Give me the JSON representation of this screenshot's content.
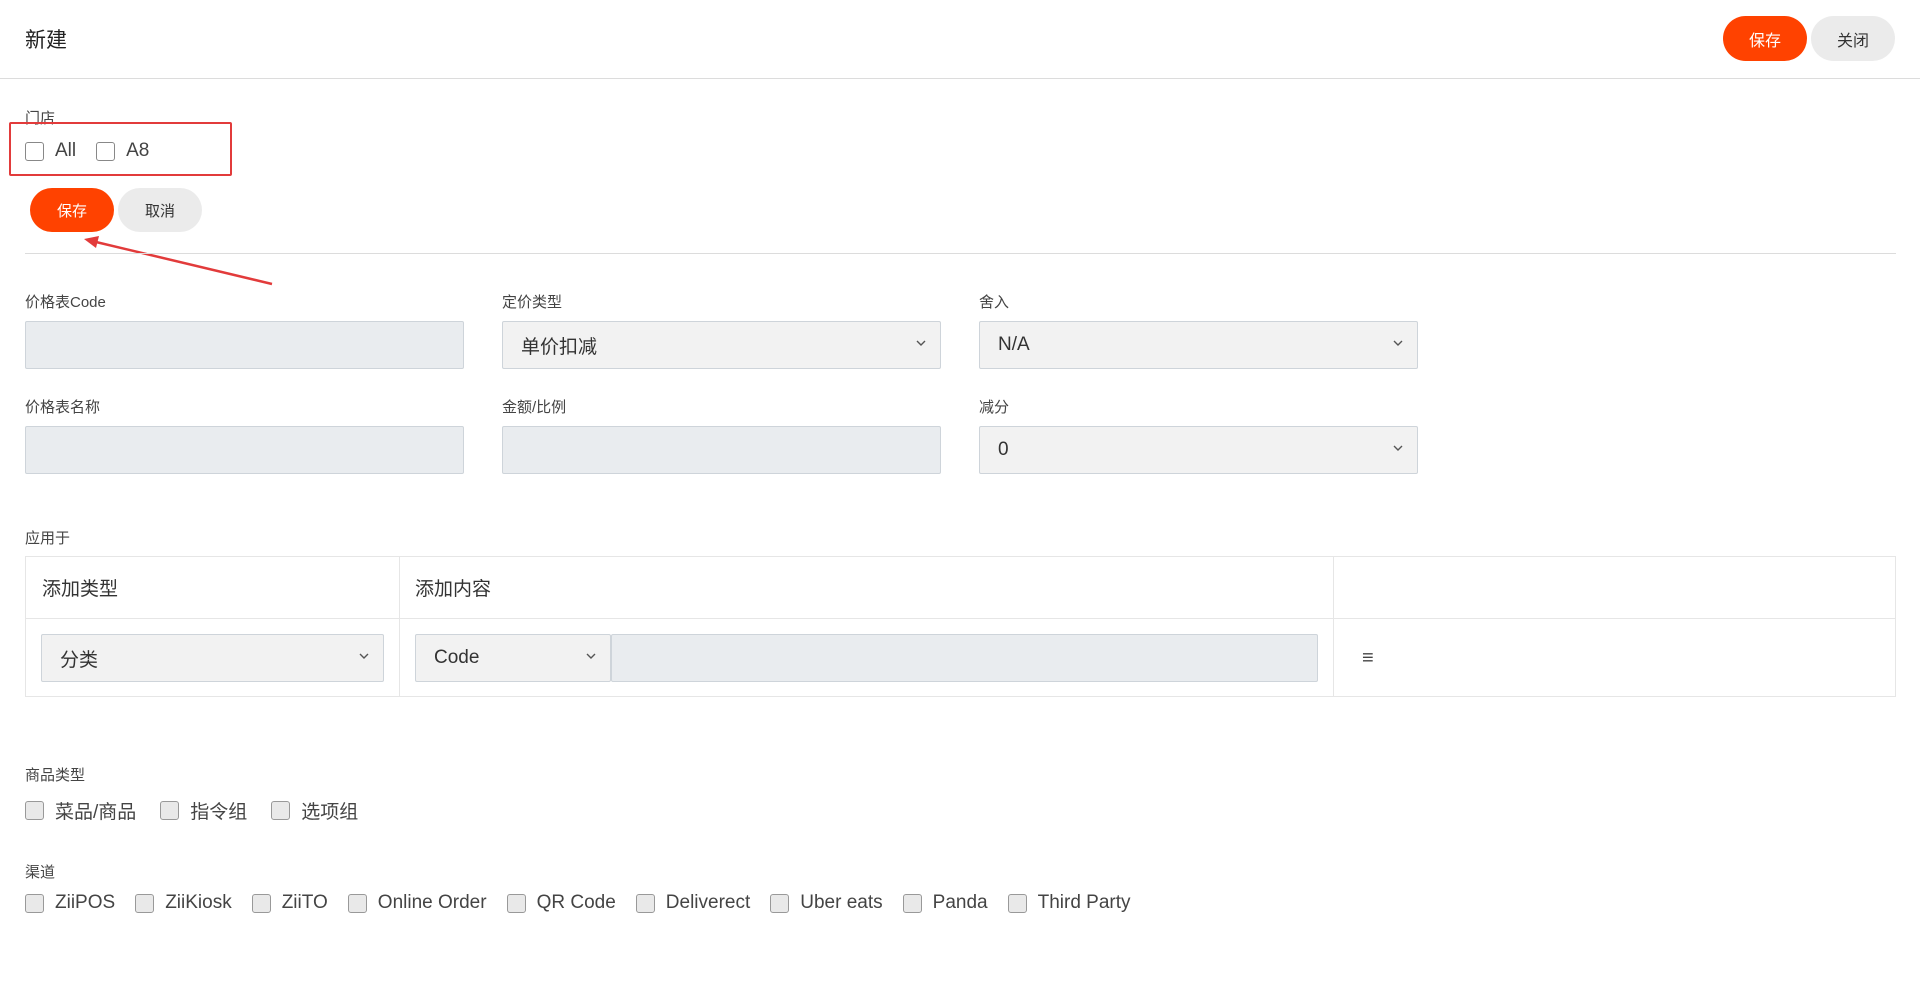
{
  "header": {
    "title": "新建",
    "save_label": "保存",
    "close_label": "关闭"
  },
  "store": {
    "label": "门店",
    "options": [
      {
        "label": "All"
      },
      {
        "label": "A8"
      }
    ],
    "save_label": "保存",
    "cancel_label": "取消"
  },
  "form": {
    "price_code_label": "价格表Code",
    "price_code_value": "",
    "pricing_type_label": "定价类型",
    "pricing_type_value": "单价扣减",
    "rounding_label": "舍入",
    "rounding_value": "N/A",
    "price_name_label": "价格表名称",
    "price_name_value": "",
    "amount_label": "金额/比例",
    "amount_value": "",
    "decimal_label": "减分",
    "decimal_value": "0"
  },
  "apply_to": {
    "label": "应用于",
    "columns": [
      "添加类型",
      "添加内容"
    ],
    "row": {
      "type_value": "分类",
      "content_type_value": "Code",
      "content_value": ""
    },
    "menu_icon": "menu-icon"
  },
  "product_type": {
    "label": "商品类型",
    "options": [
      {
        "label": "菜品/商品"
      },
      {
        "label": "指令组"
      },
      {
        "label": "选项组"
      }
    ]
  },
  "channel": {
    "label": "渠道",
    "options": [
      {
        "label": "ZiiPOS"
      },
      {
        "label": "ZiiKiosk"
      },
      {
        "label": "ZiiTO"
      },
      {
        "label": "Online Order"
      },
      {
        "label": "QR Code"
      },
      {
        "label": "Deliverect"
      },
      {
        "label": "Uber eats"
      },
      {
        "label": "Panda"
      },
      {
        "label": "Third Party"
      }
    ]
  },
  "colors": {
    "accent": "#ff4200",
    "highlight": "#e23b3b"
  }
}
